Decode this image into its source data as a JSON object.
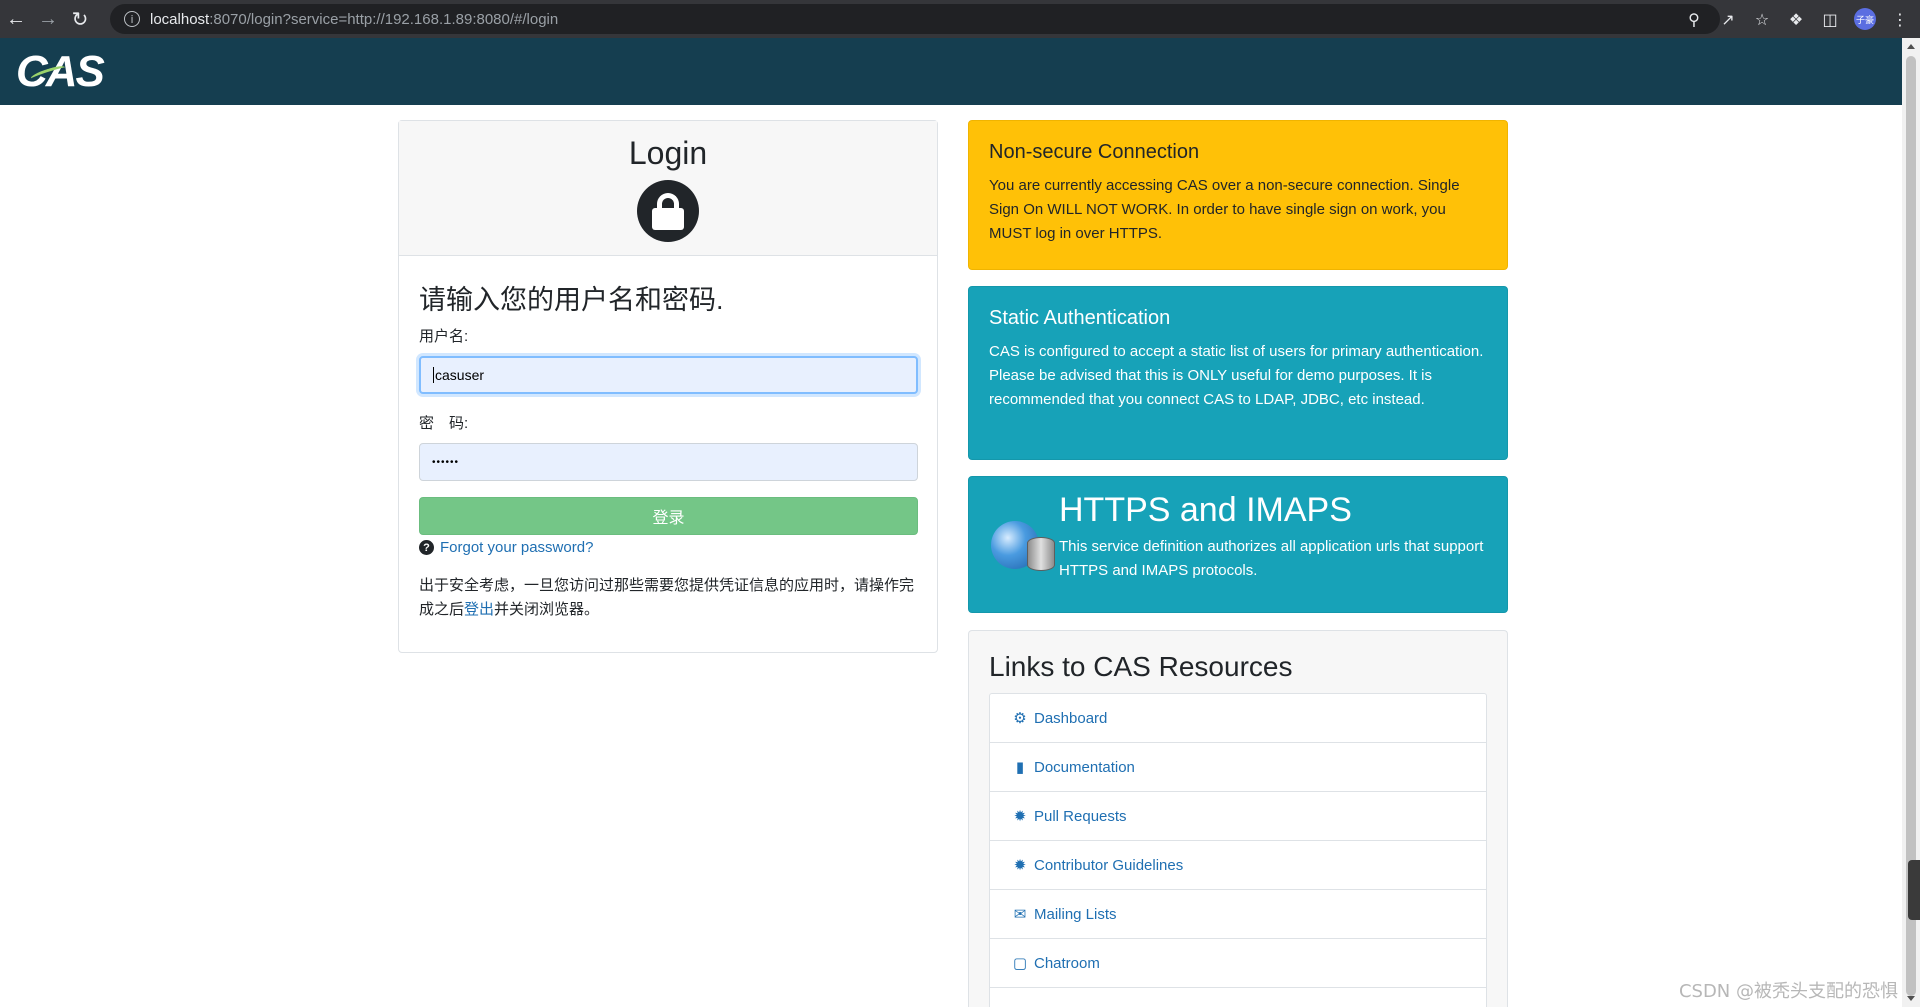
{
  "browser": {
    "url_host": "localhost",
    "url_rest": ":8070/login?service=http://192.168.1.89:8080/#/login",
    "profile_initials": "子豪"
  },
  "header": {
    "logo_text": "CAS"
  },
  "login": {
    "title": "Login",
    "prompt": "请输入您的用户名和密码.",
    "username_label": "用户名:",
    "username_value": "casuser",
    "password_label": "密　码:",
    "password_value": "••••••",
    "submit_label": "登录",
    "forgot_label": "Forgot your password?",
    "notice_before": "出于安全考虑，一旦您访问过那些需要您提供凭证信息的应用时，请操作完成之后",
    "notice_link": "登出",
    "notice_after": "并关闭浏览器。"
  },
  "panels": {
    "nonsecure": {
      "title": "Non-secure Connection",
      "text": "You are currently accessing CAS over a non-secure connection. Single Sign On WILL NOT WORK. In order to have single sign on work, you MUST log in over HTTPS."
    },
    "static_auth": {
      "title": "Static Authentication",
      "text": "CAS is configured to accept a static list of users for primary authentication. Please be advised that this is ONLY useful for demo purposes. It is recommended that you connect CAS to LDAP, JDBC, etc instead."
    },
    "https": {
      "title": "HTTPS and IMAPS",
      "text": "This service definition authorizes all application urls that support HTTPS and IMAPS protocols."
    }
  },
  "resources": {
    "title": "Links to CAS Resources",
    "items": [
      {
        "label": "Dashboard",
        "icon": "cogs-icon"
      },
      {
        "label": "Documentation",
        "icon": "file-icon"
      },
      {
        "label": "Pull Requests",
        "icon": "bug-icon"
      },
      {
        "label": "Contributor Guidelines",
        "icon": "bug-icon"
      },
      {
        "label": "Mailing Lists",
        "icon": "envelope-icon"
      },
      {
        "label": "Chatroom",
        "icon": "comment-icon"
      }
    ]
  },
  "watermark": "CSDN @被秃头支配的恐惧",
  "colors": {
    "header_bg": "#153e50",
    "warning": "#ffc107",
    "info": "#17a2b8",
    "success_button": "#74c687",
    "link": "#1f6fb2"
  }
}
